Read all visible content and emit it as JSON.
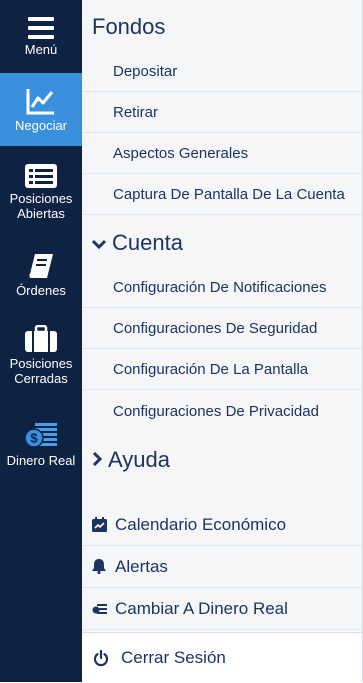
{
  "rail": {
    "items": [
      {
        "label": "Menú",
        "icon": "hamburger-icon"
      },
      {
        "label": "Negociar",
        "icon": "trade-chart-icon",
        "active": true
      },
      {
        "label": "Posiciones Abiertas",
        "icon": "list-icon"
      },
      {
        "label": "Órdenes",
        "icon": "book-icon"
      },
      {
        "label": "Posiciones Cerradas",
        "icon": "briefcase-icon"
      },
      {
        "label": "Dinero Real",
        "icon": "coin-stack-icon"
      }
    ]
  },
  "menu": {
    "fondos": {
      "title": "Fondos",
      "items": [
        "Depositar",
        "Retirar",
        "Aspectos Generales",
        "Captura De Pantalla De La Cuenta"
      ]
    },
    "cuenta": {
      "title": "Cuenta",
      "expanded": true,
      "items": [
        "Configuración De Notificaciones",
        "Configuraciones De Seguridad",
        "Configuración De La Pantalla",
        "Configuraciones De Privacidad"
      ]
    },
    "ayuda": {
      "title": "Ayuda",
      "expanded": false
    },
    "tools": [
      {
        "label": "Calendario Económico",
        "icon": "calendar-icon"
      },
      {
        "label": "Alertas",
        "icon": "bell-icon"
      },
      {
        "label": "Cambiar A Dinero Real",
        "icon": "money-switch-icon"
      }
    ],
    "logout": {
      "label": "Cerrar Sesión",
      "icon": "power-icon"
    }
  },
  "colors": {
    "rail_bg": "#0e2244",
    "rail_active": "#3a90dd",
    "text": "#1d3461",
    "panel_bg": "#f5f6f8"
  }
}
